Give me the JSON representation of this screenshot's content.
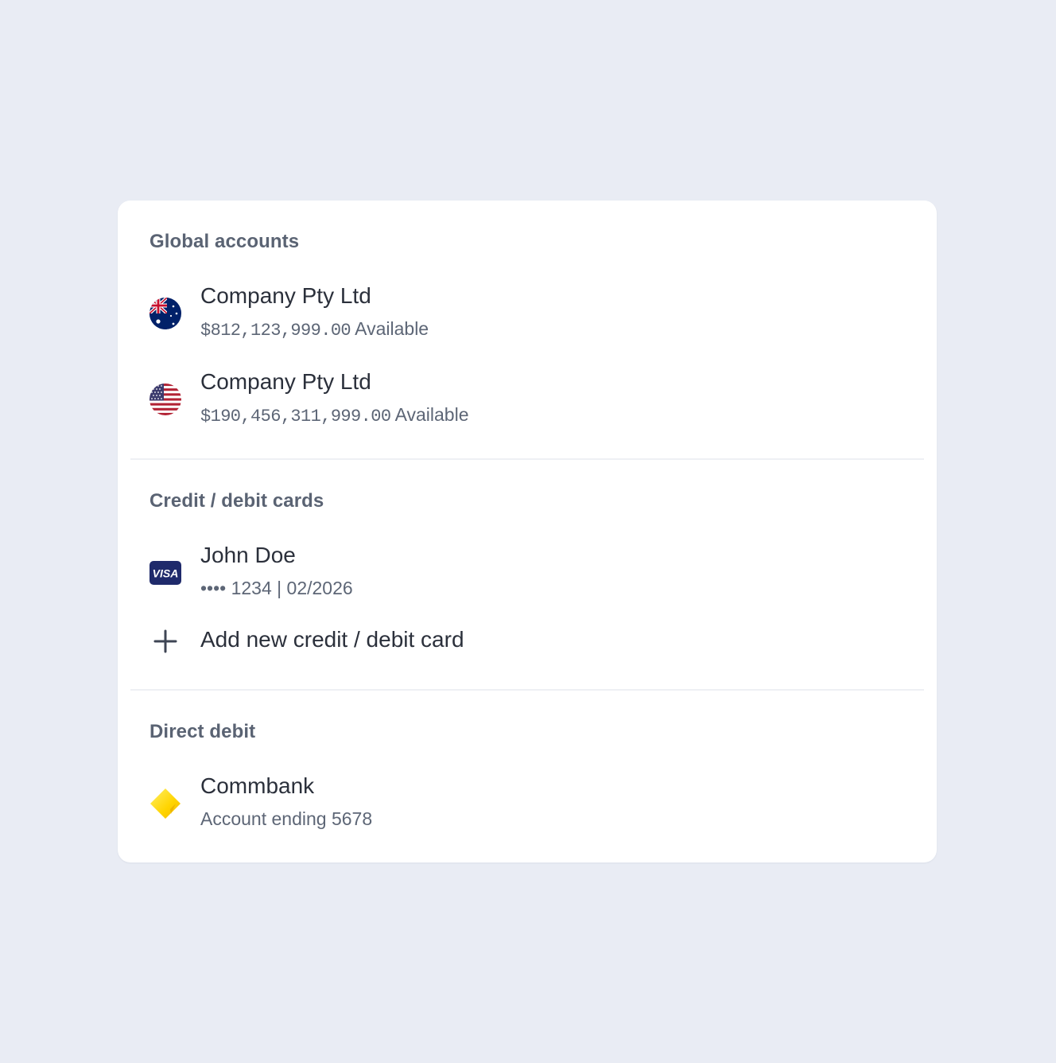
{
  "global_accounts": {
    "title": "Global accounts",
    "items": [
      {
        "name": "Company Pty Ltd",
        "amount": "$812,123,999.00",
        "suffix": "Available",
        "flag_icon": "australia-flag-icon"
      },
      {
        "name": "Company Pty Ltd",
        "amount": "$190,456,311,999.00",
        "suffix": "Available",
        "flag_icon": "usa-flag-icon"
      }
    ]
  },
  "cards": {
    "title": "Credit / debit cards",
    "items": [
      {
        "name": "John Doe",
        "masked_number": "•••• 1234",
        "separator": "|",
        "expiry": "02/2026",
        "brand_icon": "visa-icon",
        "brand_text": "VISA"
      }
    ],
    "add_label": "Add new credit / debit card"
  },
  "direct_debit": {
    "title": "Direct debit",
    "items": [
      {
        "name": "Commbank",
        "detail": "Account ending 5678",
        "bank_icon": "commbank-icon"
      }
    ]
  },
  "colors": {
    "background": "#e9ecf4",
    "card": "#ffffff",
    "section_title": "#5a6373",
    "primary_text": "#2b303b",
    "secondary_text": "#5d6676",
    "visa_blue": "#1f2a6b",
    "commbank_yellow": "#ffd400"
  }
}
